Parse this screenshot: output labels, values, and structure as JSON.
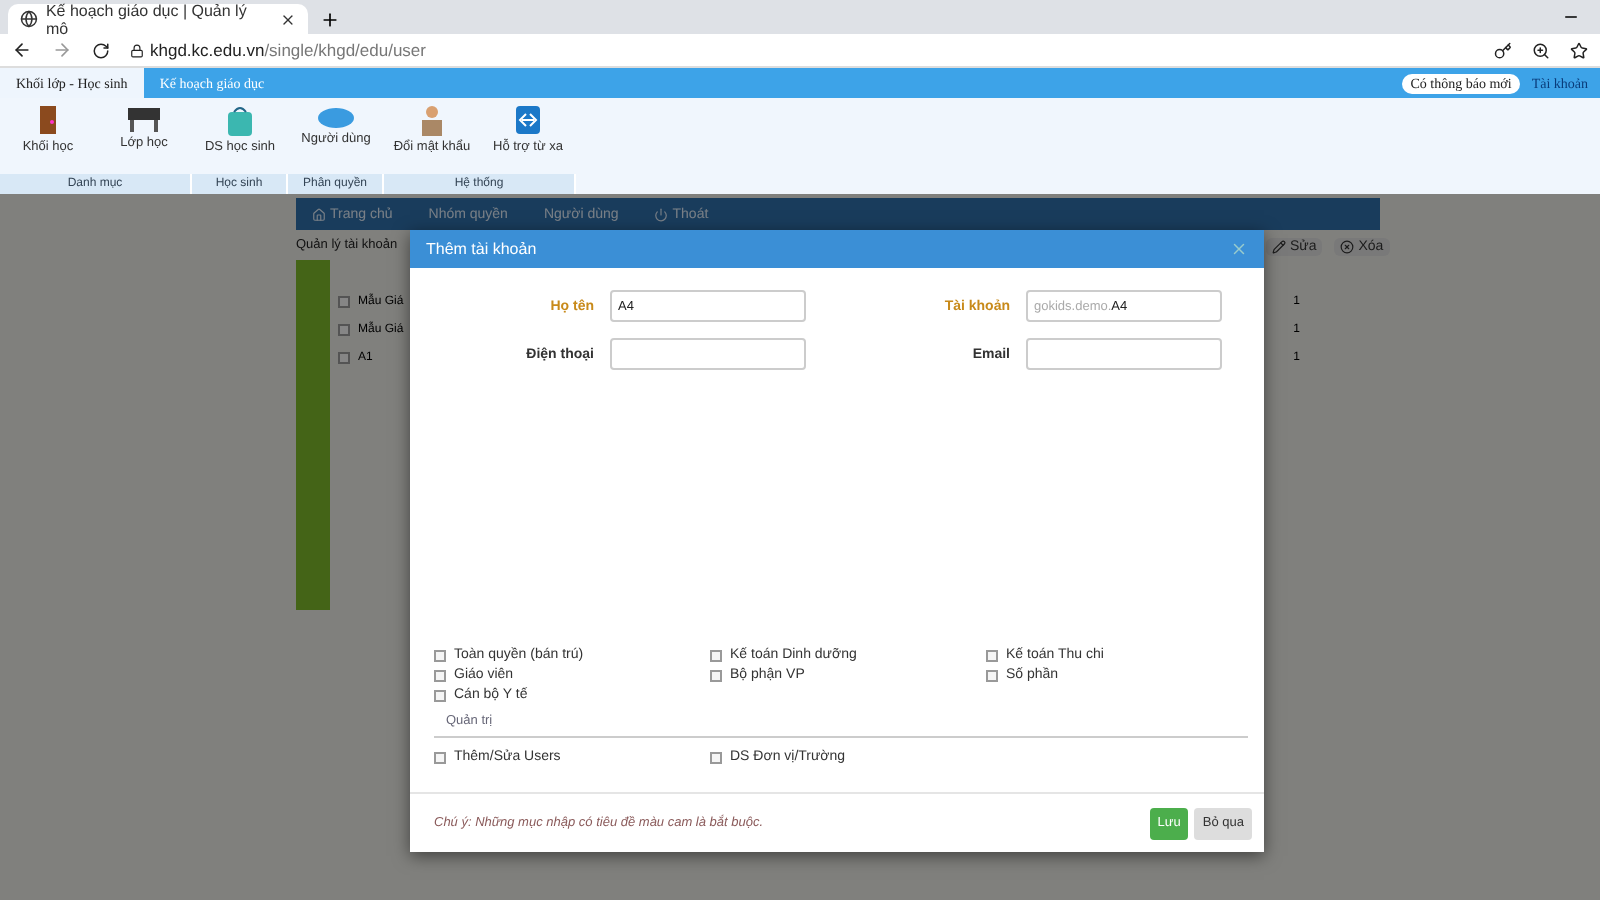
{
  "browser": {
    "tab_title": "Kế hoạch giáo dục | Quản lý mô",
    "url_host": "khgd.kc.edu.vn",
    "url_path": "/single/khgd/edu/user"
  },
  "app_tabs": [
    {
      "label": "Khối lớp - Học sinh",
      "selected": true
    },
    {
      "label": "Kế hoạch giáo dục",
      "selected": false
    }
  ],
  "notification": "Có thông báo mới",
  "account": "Tài khoản",
  "ribbon_groups": [
    {
      "label": "Danh mục",
      "items": [
        "Khối học",
        "Lớp học"
      ]
    },
    {
      "label": "Học sinh",
      "items": [
        "DS học sinh"
      ]
    },
    {
      "label": "Phân quyền",
      "items": [
        "Người dùng"
      ]
    },
    {
      "label": "Hệ thống",
      "items": [
        "Đổi mật khẩu",
        "Hỗ trợ từ xa"
      ]
    }
  ],
  "nav": [
    "Trang chủ",
    "Nhóm quyền",
    "Người dùng",
    "Thoát"
  ],
  "page_title": "Quản lý tài khoản",
  "row_actions": [
    "Sửa",
    "Xóa"
  ],
  "table_rows": [
    {
      "name": "Mẫu Giá",
      "count": "1",
      "checked": false
    },
    {
      "name": "Mẫu Giá",
      "count": "1",
      "checked": false
    },
    {
      "name": "A1",
      "count": "1",
      "checked": false
    }
  ],
  "modal": {
    "title": "Thêm tài khoản",
    "fields": [
      {
        "label": "Họ tên",
        "required": true,
        "value": "A4"
      },
      {
        "label": "Tài khoản",
        "required": true,
        "prefix": "gokids.demo.",
        "value": "A4"
      },
      {
        "label": "Điện thoại",
        "required": false
      },
      {
        "label": "Email",
        "required": false
      }
    ],
    "permission_groups": [
      {
        "items": [
          {
            "label": "Toàn quyền (bán trú)",
            "checked": false
          },
          {
            "label": "Kế toán Dinh dưỡng",
            "checked": false
          },
          {
            "label": "Kế toán Thu chi",
            "checked": false
          },
          {
            "label": "Giáo viên",
            "checked": false
          },
          {
            "label": "Bộ phận VP",
            "checked": false
          },
          {
            "label": "Số phần",
            "checked": false
          },
          {
            "label": "Cán bộ Y tế",
            "checked": false
          }
        ]
      },
      {
        "title": "Quản trị",
        "items": [
          {
            "label": "Thêm/Sửa Users",
            "checked": false
          },
          {
            "label": "DS Đơn vị/Trường",
            "checked": false
          }
        ]
      }
    ],
    "note": "Chú ý: Những mục nhập có tiêu đề màu cam là bắt buộc.",
    "buttons": [
      {
        "label": "Lưu",
        "kind": "primary"
      },
      {
        "label": "Bỏ qua",
        "kind": "default"
      }
    ]
  }
}
